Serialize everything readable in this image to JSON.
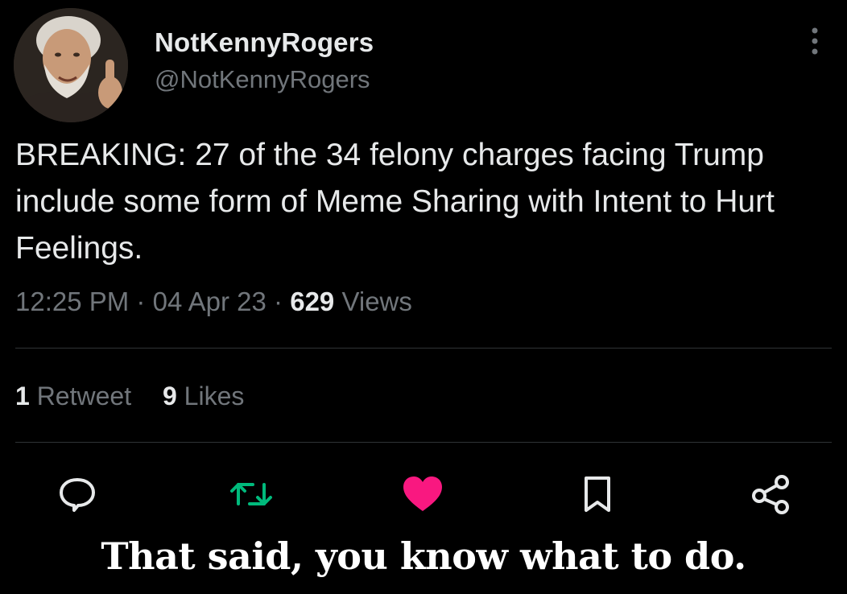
{
  "tweet": {
    "display_name": "NotKennyRogers",
    "handle": "@NotKennyRogers",
    "text": "BREAKING: 27 of the 34 felony charges facing Trump include some form of Meme Sharing with Intent to Hurt Feelings.",
    "time": "12:25 PM",
    "date": "04 Apr 23",
    "separator": "·",
    "views_count": "629",
    "views_label": "Views",
    "retweets_count": "1",
    "retweets_label": "Retweet",
    "likes_count": "9",
    "likes_label": "Likes"
  },
  "actions": [
    {
      "name": "reply",
      "icon": "reply-icon"
    },
    {
      "name": "retweet",
      "icon": "retweet-icon",
      "color": "#00ba7c"
    },
    {
      "name": "like",
      "icon": "heart-icon",
      "color": "#f91880",
      "active": true
    },
    {
      "name": "bookmark",
      "icon": "bookmark-icon"
    },
    {
      "name": "share",
      "icon": "share-icon"
    }
  ],
  "caption": "That said, you know what to do.",
  "colors": {
    "background": "#000000",
    "text_primary": "#e7e9ea",
    "text_secondary": "#71767b",
    "divider": "#2f3336",
    "retweet": "#00ba7c",
    "like": "#f91880"
  }
}
